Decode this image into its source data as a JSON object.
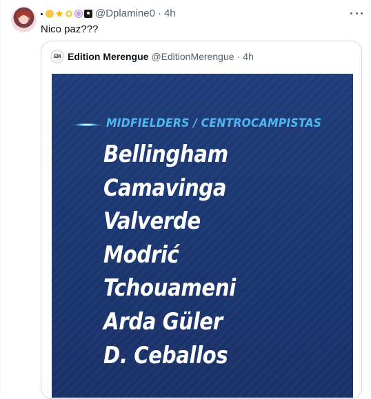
{
  "tweet": {
    "author_handle": "@Dplamine0",
    "separator": "·",
    "time": "4h",
    "text": "Nico paz???",
    "name_emojis": [
      "dot",
      "sun-with-face",
      "star",
      "dizzy",
      "spiral-shell",
      "pirate-flag"
    ]
  },
  "quote": {
    "author_name": "Edition Merengue",
    "author_handle": "@EditionMerengue",
    "separator": "·",
    "time": "4h",
    "avatar_text": "EM",
    "media": {
      "section_title": "MIDFIELDERS / CENTROCAMPISTAS",
      "players": [
        "Bellingham",
        "Camavinga",
        "Valverde",
        "Modrić",
        "Tchouameni",
        "Arda Güler",
        "D. Ceballos"
      ],
      "accent_color": "#4fb8f0",
      "background_color": "#1f3d7a"
    }
  },
  "icons": {
    "more": "more-horizontal-icon",
    "avatar": "user-avatar"
  }
}
